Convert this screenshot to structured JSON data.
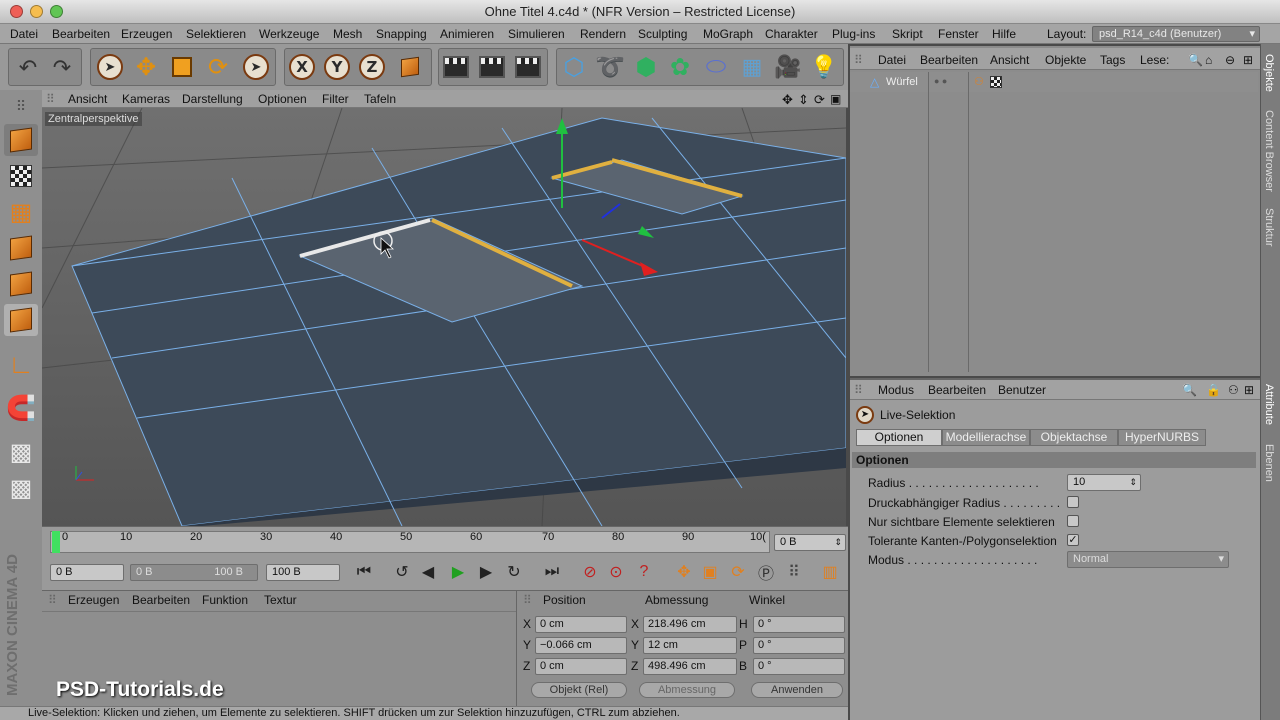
{
  "window": {
    "title": "Ohne Titel 4.c4d * (NFR Version – Restricted License)"
  },
  "menubar": {
    "items": [
      "Datei",
      "Bearbeiten",
      "Erzeugen",
      "Selektieren",
      "Werkzeuge",
      "Mesh",
      "Snapping",
      "Animieren",
      "Simulieren",
      "Rendern",
      "Sculpting",
      "MoGraph",
      "Charakter",
      "Plug-ins",
      "Skript",
      "Fenster",
      "Hilfe"
    ],
    "layout_label": "Layout:",
    "layout_value": "psd_R14_c4d (Benutzer)"
  },
  "toolbar": {
    "axis_x": "X",
    "axis_y": "Y",
    "axis_z": "Z"
  },
  "viewport": {
    "menu": [
      "Ansicht",
      "Kameras",
      "Darstellung",
      "Optionen",
      "Filter",
      "Tafeln"
    ],
    "camera_label": "Zentralperspektive"
  },
  "timeline": {
    "ticks": [
      "0",
      "10",
      "20",
      "30",
      "40",
      "50",
      "60",
      "70",
      "80",
      "90",
      "10("
    ],
    "current_frame": "0 B"
  },
  "playback": {
    "start": "0 B",
    "range_start": "0 B",
    "range_end": "100 B",
    "end": "100 B"
  },
  "material": {
    "menu": [
      "Erzeugen",
      "Bearbeiten",
      "Funktion",
      "Textur"
    ]
  },
  "brand": {
    "logo_text": "MAXON CINEMA 4D",
    "watermark": "PSD-Tutorials.de"
  },
  "coordinates": {
    "headers": [
      "Position",
      "Abmessung",
      "Winkel"
    ],
    "position": [
      {
        "axis": "X",
        "value": "0 cm"
      },
      {
        "axis": "Y",
        "value": "−0.066 cm"
      },
      {
        "axis": "Z",
        "value": "0 cm"
      }
    ],
    "size": [
      {
        "axis": "X",
        "value": "218.496 cm"
      },
      {
        "axis": "Y",
        "value": "12 cm"
      },
      {
        "axis": "Z",
        "value": "498.496 cm"
      }
    ],
    "rotation": [
      {
        "axis": "H",
        "value": "0 °"
      },
      {
        "axis": "P",
        "value": "0 °"
      },
      {
        "axis": "B",
        "value": "0 °"
      }
    ],
    "mode1": "Objekt (Rel)",
    "mode2": "Abmessung",
    "apply": "Anwenden"
  },
  "status": "Live-Selektion: Klicken und ziehen, um Elemente zu selektieren. SHIFT drücken um zur Selektion hinzuzufügen, CTRL zum abziehen.",
  "objects": {
    "menu": [
      "Datei",
      "Bearbeiten",
      "Ansicht",
      "Objekte",
      "Tags",
      "Lese:"
    ],
    "items": [
      {
        "name": "Würfel"
      }
    ]
  },
  "attributes": {
    "menu": [
      "Modus",
      "Bearbeiten",
      "Benutzer"
    ],
    "tool_name": "Live-Selektion",
    "tabs": [
      "Optionen",
      "Modellierachse",
      "Objektachse",
      "HyperNURBS"
    ],
    "section": "Optionen",
    "radius_label": "Radius . . . . . . . . . . . . . . . . . . . .",
    "radius_value": "10",
    "pressure_label": "Druckabhängiger Radius . . . . . . . . .",
    "visible_label": "Nur sichtbare Elemente selektieren",
    "tolerant_label": "Tolerante Kanten-/Polygonselektion",
    "mode_label": "Modus . . . . . . . . . . . . . . . . . . . .",
    "mode_value": "Normal"
  },
  "sidetabs": [
    "Objekte",
    "Content Browser",
    "Struktur",
    "Attribute",
    "Ebenen"
  ]
}
